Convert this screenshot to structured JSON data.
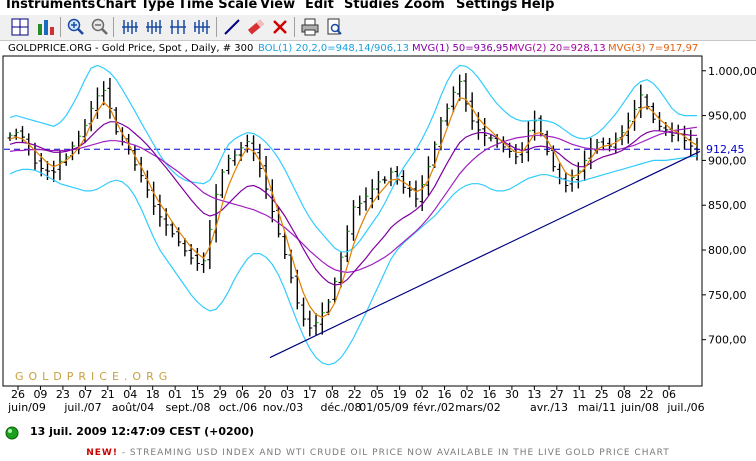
{
  "menu": [
    "Instruments",
    "Chart Type",
    "Time Scale",
    "View",
    "Edit",
    "Studies",
    "Zoom",
    "Settings",
    "Help"
  ],
  "toolbar": {
    "buttons": [
      "crosshair-icon",
      "chart-settings-icon",
      "zoom-in-icon",
      "zoom-out-icon",
      "scale-range-icon",
      "scale-range-alt-icon",
      "scale-range-wide-icon",
      "scale-range-narrow-icon",
      "draw-line-icon",
      "eraser-icon",
      "delete-icon",
      "print-icon",
      "print-preview-icon"
    ]
  },
  "chart": {
    "header": {
      "symbol": "GOLDPRICE.ORG - Gold Price, Spot , Daily, # 300",
      "bol": "BOL(1) 20,2,0=948,14/906,13",
      "mvg1": "MVG(1) 50=936,95",
      "mvg2": "MVG(2) 20=928,13",
      "mvg3": "MVG(3) 7=917,97"
    },
    "watermark": "GOLDPRICE.ORG",
    "current_price_label": "912,45",
    "colors": {
      "price_bars": "#000000",
      "up_close_tick": "#00a000",
      "bollinger": "#33ccff",
      "mvg50": "#a020c0",
      "mvg20": "#8000a0",
      "mvg7": "#e08000",
      "trendline": "#000080",
      "price_line": "#0000cc",
      "bol_text": "#1aa0e0",
      "mvg1_text": "#8800aa",
      "mvg2_text": "#a000a0",
      "mvg3_text": "#e06010"
    }
  },
  "chart_data": {
    "type": "line",
    "title": "GOLDPRICE.ORG - Gold Price, Spot , Daily, # 300",
    "xlabel": "",
    "ylabel": "",
    "ylim": [
      655,
      1012
    ],
    "y_ticks": [
      "1.000,00",
      "950,00",
      "900,00",
      "850,00",
      "800,00",
      "750,00",
      "700,00"
    ],
    "y_tick_values": [
      1000,
      950,
      900,
      850,
      800,
      750,
      700
    ],
    "x_day_labels": [
      "26",
      "09",
      "23",
      "07",
      "21",
      "04",
      "18",
      "01",
      "15",
      "29",
      "06",
      "20",
      "03",
      "17",
      "08",
      "22",
      "05",
      "19",
      "02",
      "16",
      "02",
      "16",
      "30",
      "13",
      "27",
      "11",
      "25",
      "08",
      "22",
      "06"
    ],
    "x_month_labels": [
      "juin/09",
      "juil./07",
      "août/04",
      "sept./08",
      "oct./06",
      "nov./03",
      "déc./08",
      "01/05/09",
      "févr./02",
      "mars/02",
      "avr./13",
      "mai/11",
      "juin/08",
      "juil./06"
    ],
    "grid": false,
    "legend": "top",
    "series": [
      {
        "name": "Gold Price, Spot",
        "values": [
          928,
          931,
          926,
          912,
          897,
          891,
          888,
          887,
          899,
          904,
          916,
          927,
          939,
          958,
          972,
          978,
          958,
          932,
          921,
          912,
          895,
          883,
          867,
          849,
          837,
          828,
          818,
          809,
          799,
          791,
          785,
          788,
          823,
          862,
          887,
          902,
          906,
          914,
          921,
          908,
          891,
          868,
          843,
          818,
          795,
          769,
          741,
          723,
          713,
          719,
          730,
          742,
          765,
          792,
          821,
          848,
          852,
          860,
          868,
          876,
          878,
          887,
          879,
          870,
          867,
          857,
          873,
          893,
          918,
          944,
          958,
          976,
          988,
          963,
          944,
          934,
          928,
          925,
          919,
          915,
          910,
          904,
          911,
          933,
          944,
          930,
          910,
          893,
          880,
          872,
          881,
          888,
          900,
          913,
          920,
          916,
          916,
          924,
          931,
          944,
          957,
          973,
          960,
          946,
          938,
          934,
          928,
          930,
          922,
          916,
          912
        ]
      },
      {
        "name": "MVG(3) 7",
        "values": [
          924,
          926,
          924,
          918,
          911,
          904,
          897,
          893,
          896,
          900,
          906,
          914,
          925,
          941,
          955,
          965,
          958,
          943,
          930,
          918,
          905,
          893,
          879,
          864,
          852,
          842,
          831,
          821,
          812,
          803,
          796,
          791,
          804,
          826,
          851,
          872,
          888,
          903,
          914,
          910,
          900,
          885,
          864,
          842,
          820,
          796,
          772,
          752,
          737,
          728,
          725,
          729,
          741,
          760,
          782,
          806,
          824,
          840,
          852,
          862,
          870,
          878,
          879,
          876,
          871,
          865,
          868,
          878,
          895,
          917,
          936,
          955,
          970,
          968,
          958,
          947,
          939,
          933,
          926,
          920,
          914,
          909,
          909,
          919,
          930,
          931,
          923,
          911,
          898,
          886,
          882,
          884,
          891,
          902,
          912,
          916,
          917,
          920,
          925,
          934,
          945,
          958,
          960,
          954,
          946,
          940,
          934,
          931,
          927,
          921,
          917
        ]
      },
      {
        "name": "MVG(2) 20",
        "values": [
          918,
          920,
          920,
          919,
          917,
          914,
          911,
          909,
          909,
          910,
          912,
          915,
          920,
          927,
          934,
          940,
          943,
          943,
          940,
          936,
          930,
          924,
          917,
          909,
          900,
          892,
          883,
          874,
          865,
          856,
          848,
          841,
          838,
          840,
          845,
          852,
          859,
          866,
          871,
          872,
          869,
          864,
          857,
          848,
          838,
          826,
          814,
          801,
          789,
          778,
          770,
          764,
          761,
          762,
          767,
          775,
          783,
          791,
          800,
          808,
          816,
          825,
          831,
          836,
          840,
          845,
          851,
          860,
          871,
          884,
          897,
          909,
          920,
          926,
          929,
          931,
          931,
          929,
          925,
          921,
          917,
          913,
          911,
          912,
          915,
          916,
          915,
          912,
          907,
          901,
          896,
          893,
          893,
          897,
          901,
          904,
          906,
          908,
          911,
          916,
          921,
          927,
          931,
          933,
          933,
          932,
          931,
          930,
          929,
          928,
          928
        ]
      },
      {
        "name": "MVG(1) 50",
        "values": [
          910,
          911,
          911,
          912,
          912,
          912,
          911,
          911,
          911,
          911,
          912,
          913,
          915,
          917,
          919,
          921,
          922,
          922,
          921,
          919,
          917,
          914,
          910,
          906,
          902,
          897,
          892,
          887,
          881,
          876,
          870,
          864,
          860,
          857,
          855,
          853,
          851,
          849,
          847,
          845,
          842,
          839,
          835,
          830,
          825,
          819,
          813,
          806,
          799,
          793,
          787,
          782,
          778,
          776,
          775,
          776,
          778,
          781,
          784,
          788,
          792,
          797,
          803,
          809,
          815,
          821,
          828,
          836,
          845,
          855,
          865,
          875,
          885,
          893,
          900,
          906,
          911,
          915,
          918,
          921,
          923,
          925,
          926,
          927,
          928,
          928,
          927,
          926,
          924,
          921,
          918,
          916,
          914,
          913,
          912,
          912,
          912,
          912,
          913,
          915,
          917,
          920,
          923,
          926,
          929,
          931,
          933,
          934,
          935,
          936,
          937
        ]
      },
      {
        "name": "BOL(1) upper",
        "values": [
          948,
          950,
          948,
          946,
          944,
          942,
          940,
          938,
          942,
          950,
          962,
          975,
          990,
          1003,
          1006,
          1003,
          998,
          990,
          979,
          967,
          955,
          942,
          930,
          918,
          906,
          896,
          888,
          882,
          878,
          876,
          875,
          874,
          878,
          890,
          905,
          918,
          924,
          928,
          931,
          930,
          926,
          920,
          912,
          902,
          890,
          876,
          862,
          848,
          836,
          826,
          818,
          810,
          802,
          798,
          798,
          802,
          810,
          820,
          830,
          840,
          852,
          866,
          880,
          892,
          902,
          912,
          924,
          938,
          954,
          972,
          988,
          1000,
          1006,
          1005,
          1000,
          992,
          982,
          972,
          963,
          956,
          950,
          946,
          944,
          944,
          945,
          945,
          944,
          942,
          938,
          933,
          928,
          925,
          924,
          926,
          930,
          936,
          944,
          952,
          962,
          972,
          982,
          988,
          990,
          986,
          978,
          968,
          958,
          952,
          950,
          950,
          950
        ]
      },
      {
        "name": "BOL(1) lower",
        "values": [
          885,
          888,
          890,
          890,
          889,
          886,
          882,
          878,
          874,
          872,
          870,
          868,
          866,
          866,
          868,
          872,
          876,
          878,
          876,
          870,
          860,
          846,
          830,
          814,
          800,
          790,
          780,
          770,
          760,
          750,
          742,
          736,
          732,
          734,
          742,
          754,
          768,
          780,
          790,
          796,
          796,
          792,
          784,
          772,
          756,
          738,
          720,
          704,
          690,
          680,
          674,
          672,
          674,
          680,
          690,
          702,
          716,
          730,
          745,
          760,
          775,
          790,
          800,
          808,
          814,
          820,
          826,
          832,
          838,
          846,
          854,
          862,
          868,
          872,
          874,
          874,
          872,
          868,
          866,
          866,
          868,
          872,
          876,
          880,
          882,
          884,
          884,
          882,
          880,
          878,
          876,
          876,
          878,
          880,
          882,
          884,
          886,
          888,
          890,
          892,
          894,
          896,
          898,
          900,
          900,
          900,
          901,
          902,
          903,
          904,
          905
        ]
      },
      {
        "name": "Trendline",
        "values": [
          680,
          910
        ]
      },
      {
        "name": "Price Line",
        "values": [
          912.45
        ]
      }
    ]
  },
  "status": {
    "text": "13 juil. 2009 12:47:09  CEST (+0200)",
    "dot_color": "#1aa01a"
  },
  "ticker": {
    "new_label": "NEW!",
    "text": " - STREAMING USD INDEX AND WTI CRUDE OIL PRICE NOW AVAILABLE IN THE LIVE GOLD PRICE CHART"
  }
}
